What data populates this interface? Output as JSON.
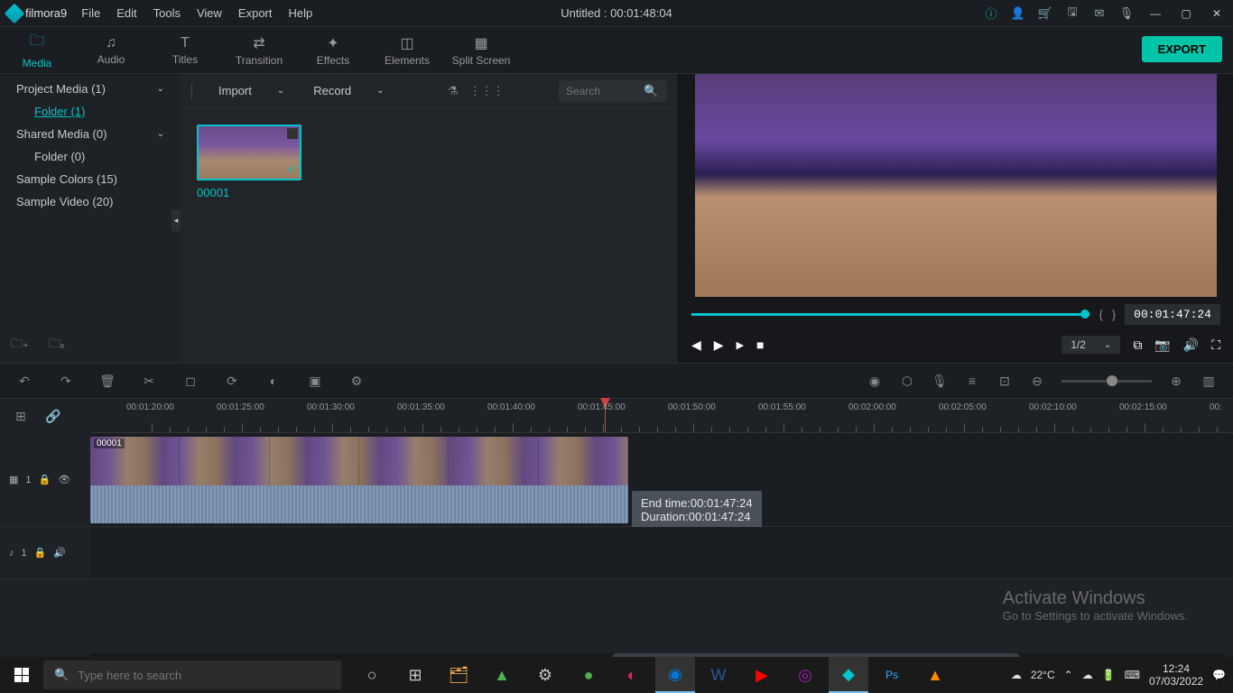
{
  "app": {
    "name": "filmora9",
    "title": "Untitled : 00:01:48:04"
  },
  "menubar": [
    "File",
    "Edit",
    "Tools",
    "View",
    "Export",
    "Help"
  ],
  "tabs": [
    {
      "label": "Media",
      "icon": "folder"
    },
    {
      "label": "Audio",
      "icon": "music"
    },
    {
      "label": "Titles",
      "icon": "text"
    },
    {
      "label": "Transition",
      "icon": "transition"
    },
    {
      "label": "Effects",
      "icon": "sparkle"
    },
    {
      "label": "Elements",
      "icon": "layers"
    },
    {
      "label": "Split Screen",
      "icon": "split"
    }
  ],
  "export_label": "EXPORT",
  "sidebar": {
    "items": [
      {
        "label": "Project Media (1)",
        "expandable": true
      },
      {
        "label": "Folder (1)",
        "sub": true,
        "selected": true
      },
      {
        "label": "Shared Media (0)",
        "expandable": true
      },
      {
        "label": "Folder (0)",
        "sub": true
      },
      {
        "label": "Sample Colors (15)"
      },
      {
        "label": "Sample Video (20)"
      }
    ]
  },
  "media_bar": {
    "import": "Import",
    "record": "Record",
    "search_placeholder": "Search"
  },
  "media_items": [
    {
      "name": "00001"
    }
  ],
  "preview": {
    "timecode": "00:01:47:24",
    "quality": "1/2",
    "markers": {
      "in": "{",
      "out": "}"
    }
  },
  "ruler_marks": [
    "00:01:20:00",
    "00:01:25:00",
    "00:01:30:00",
    "00:01:35:00",
    "00:01:40:00",
    "00:01:45:00",
    "00:01:50:00",
    "00:01:55:00",
    "00:02:00:00",
    "00:02:05:00",
    "00:02:10:00",
    "00:02:15:00",
    "00:"
  ],
  "tracks": {
    "video": {
      "label": "1",
      "clip_name": "00001"
    },
    "audio": {
      "label": "1"
    }
  },
  "tooltip": {
    "end": "End time:00:01:47:24",
    "duration": "Duration:00:01:47:24"
  },
  "activate": {
    "title": "Activate Windows",
    "sub": "Go to Settings to activate Windows."
  },
  "taskbar": {
    "search_placeholder": "Type here to search",
    "weather": "22°C",
    "time": "12:24",
    "date": "07/03/2022"
  }
}
